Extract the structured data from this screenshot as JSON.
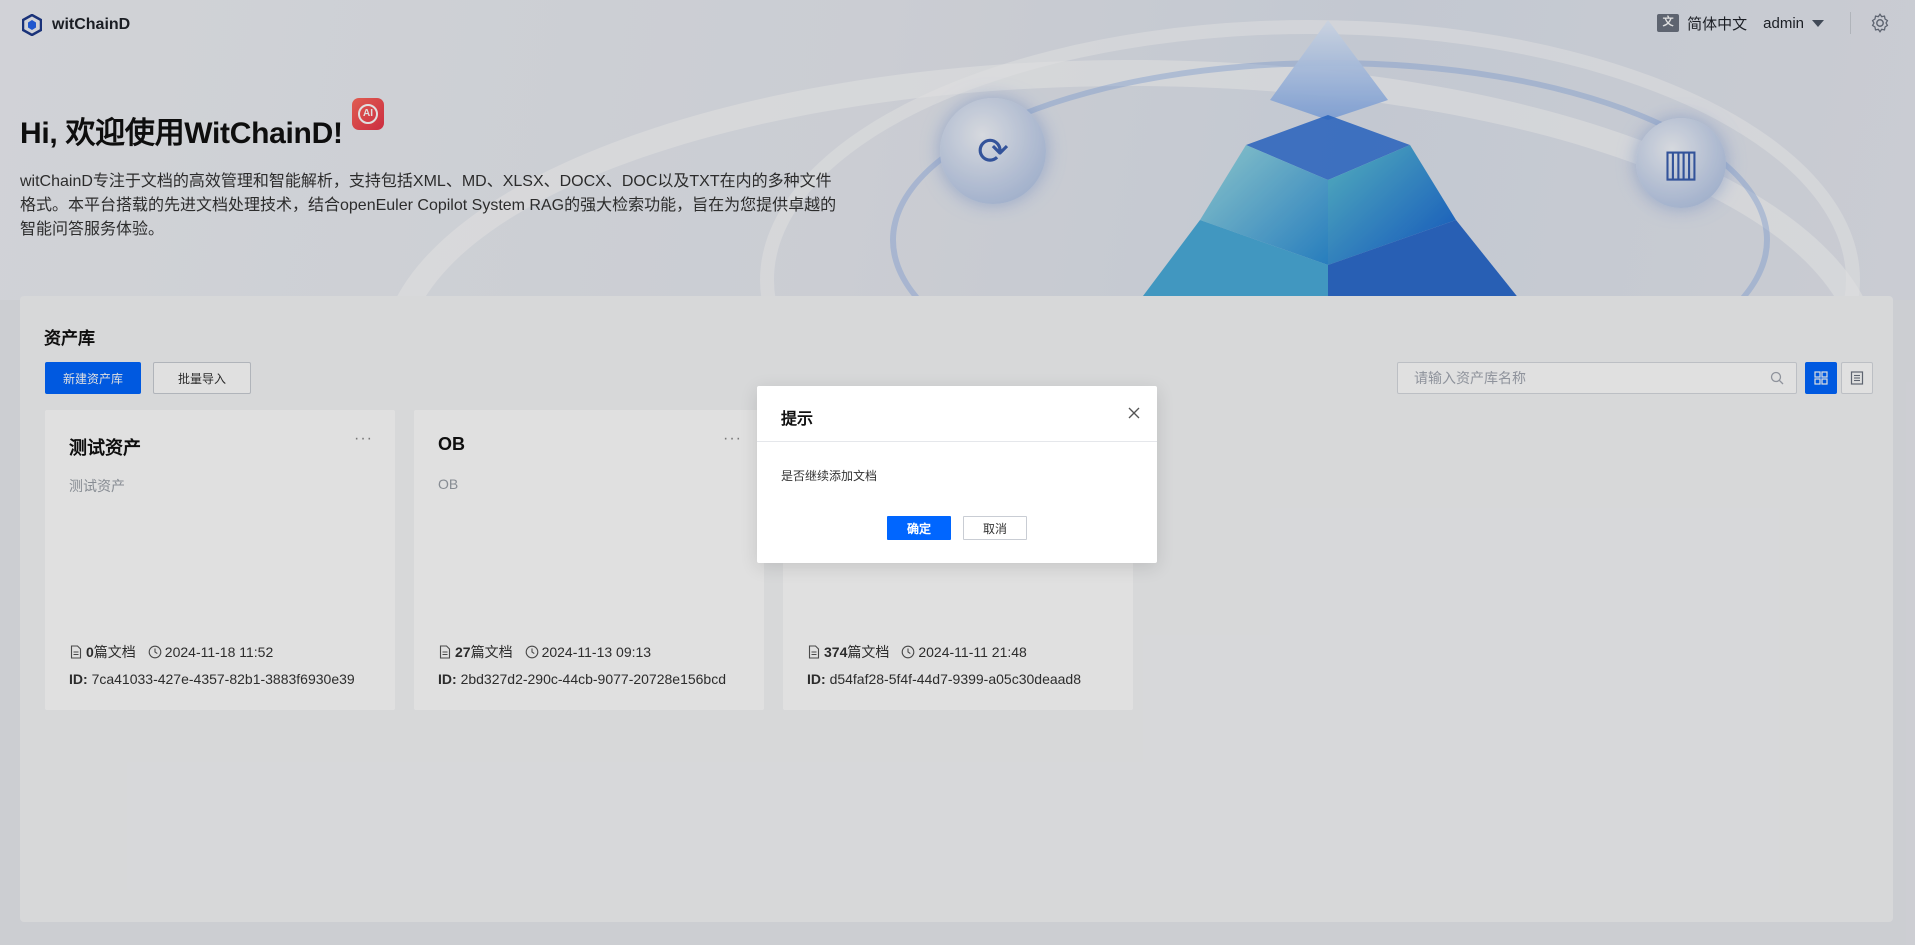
{
  "app": {
    "name": "witChainD"
  },
  "header": {
    "language": "简体中文",
    "language_icon": "translate-icon",
    "user": "admin",
    "settings_icon": "gear-icon"
  },
  "hero": {
    "title": "Hi, 欢迎使用WitChainD!",
    "badge": "AI",
    "description": "witChainD专注于文档的高效管理和智能解析，支持包括XML、MD、XLSX、DOCX、DOC以及TXT在内的多种文件格式。本平台搭载的先进文档处理技术，结合openEuler Copilot System RAG的强大检索功能，旨在为您提供卓越的智能问答服务体验。"
  },
  "library": {
    "title": "资产库",
    "new_button": "新建资产库",
    "import_button": "批量导入",
    "search_placeholder": "请输入资产库名称",
    "cards": [
      {
        "title": "测试资产",
        "more": "···",
        "description": "测试资产",
        "doc_count": "0",
        "doc_suffix": "篇文档",
        "time": "2024-11-18 11:52",
        "id_label": "ID:",
        "id": "7ca41033-427e-4357-82b1-3883f6930e39"
      },
      {
        "title": "OB",
        "more": "···",
        "description": "OB",
        "doc_count": "27",
        "doc_suffix": "篇文档",
        "time": "2024-11-13 09:13",
        "id_label": "ID:",
        "id": "2bd327d2-290c-44cb-9077-20728e156bcd"
      },
      {
        "title": "",
        "more": "",
        "description": "",
        "doc_count": "374",
        "doc_suffix": "篇文档",
        "time": "2024-11-11 21:48",
        "id_label": "ID:",
        "id": "d54faf28-5f4f-44d7-9399-a05c30deaad8"
      }
    ]
  },
  "dialog": {
    "title": "提示",
    "message": "是否继续添加文档",
    "ok": "确定",
    "cancel": "取消"
  },
  "colors": {
    "primary": "#0066ff",
    "ai_badge": "#e8334a"
  }
}
